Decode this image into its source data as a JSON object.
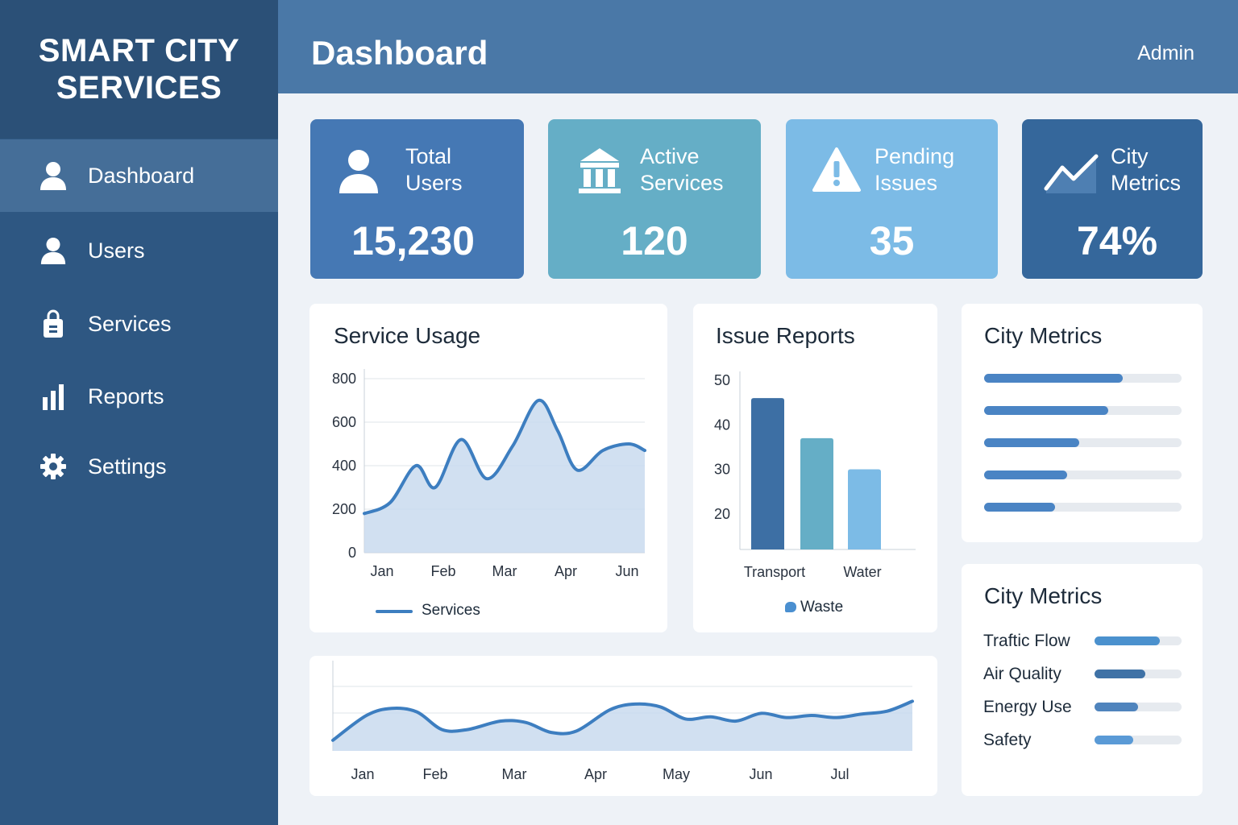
{
  "brand": {
    "title": "SMART CITY SERVICES"
  },
  "header": {
    "title": "Dashboard",
    "user": "Admin"
  },
  "sidebar": {
    "items": [
      {
        "label": "Dashboard",
        "icon": "user-icon",
        "active": true
      },
      {
        "label": "Users",
        "icon": "user-icon",
        "active": false
      },
      {
        "label": "Services",
        "icon": "lock-bag-icon",
        "active": false
      },
      {
        "label": "Reports",
        "icon": "bar-chart-icon",
        "active": false
      },
      {
        "label": "Settings",
        "icon": "gear-icon",
        "active": false
      }
    ]
  },
  "stats": [
    {
      "label_line1": "Total",
      "label_line2": "Users",
      "value": "15,230",
      "icon": "user-icon",
      "color": "#4578b4"
    },
    {
      "label_line1": "Active",
      "label_line2": "Services",
      "value": "120",
      "icon": "building-icon",
      "color": "#65aec6"
    },
    {
      "label_line1": "Pending",
      "label_line2": "Issues",
      "value": "35",
      "icon": "warning-icon",
      "color": "#7cbbe6"
    },
    {
      "label_line1": "City",
      "label_line2": "Metrics",
      "value": "74%",
      "icon": "trend-icon",
      "color": "#35679b"
    }
  ],
  "service_usage": {
    "title": "Service Usage",
    "legend": "Services",
    "chart_data": {
      "type": "area",
      "title": "Service Usage",
      "categories": [
        "Jan",
        "Feb",
        "Mar",
        "Apr",
        "Jun"
      ],
      "yticks": [
        0,
        200,
        400,
        600,
        800
      ],
      "ylim": [
        0,
        800
      ],
      "series": [
        {
          "name": "Services",
          "x": [
            0,
            0.4,
            0.8,
            1.1,
            1.5,
            1.9,
            2.3,
            2.7,
            3.0,
            3.3,
            3.7,
            4.1,
            4.35
          ],
          "values": [
            180,
            230,
            400,
            300,
            520,
            340,
            490,
            700,
            560,
            380,
            470,
            500,
            470
          ]
        }
      ],
      "grid": true,
      "legend_position": "bottom"
    }
  },
  "issue_reports": {
    "title": "Issue Reports",
    "legend": "Waste",
    "chart_data": {
      "type": "bar",
      "title": "Issue Reports",
      "categories": [
        "Transport",
        "",
        "Water"
      ],
      "yticks": [
        20,
        30,
        40,
        50
      ],
      "ylim": [
        12,
        52
      ],
      "values": [
        46,
        37,
        30
      ],
      "colors": [
        "#3d6fa4",
        "#65aec6",
        "#7cbbe6"
      ],
      "legend_position": "bottom"
    }
  },
  "city_metrics_bars": {
    "title": "City Metrics",
    "levels": [
      0.7,
      0.63,
      0.48,
      0.42,
      0.36
    ],
    "color": "#4a84c4"
  },
  "city_metrics_list": {
    "title": "City Metrics",
    "items": [
      {
        "name": "Traftic Flow",
        "level": 0.75,
        "color": "#4b91ce"
      },
      {
        "name": "Air Quality",
        "level": 0.58,
        "color": "#3f72a6"
      },
      {
        "name": "Energy Use",
        "level": 0.5,
        "color": "#4f84bd"
      },
      {
        "name": "Safety",
        "level": 0.44,
        "color": "#5a9ad6"
      }
    ]
  },
  "trend_chart": {
    "chart_data": {
      "type": "area",
      "categories": [
        "Jan",
        "Feb",
        "Mar",
        "Apr",
        "May",
        "Jun",
        "Jul"
      ],
      "series": [
        {
          "x": [
            0,
            0.4,
            0.7,
            1.0,
            1.3,
            1.6,
            2.0,
            2.3,
            2.6,
            2.9,
            3.3,
            3.6,
            3.9,
            4.2,
            4.5,
            4.8,
            5.1,
            5.4,
            5.7,
            6.0,
            6.3,
            6.6,
            6.9
          ],
          "values": [
            15,
            50,
            60,
            55,
            30,
            30,
            42,
            40,
            26,
            28,
            58,
            66,
            62,
            45,
            48,
            42,
            53,
            47,
            50,
            47,
            52,
            56,
            70
          ]
        }
      ],
      "ylim": [
        0,
        100
      ],
      "grid": true
    }
  }
}
